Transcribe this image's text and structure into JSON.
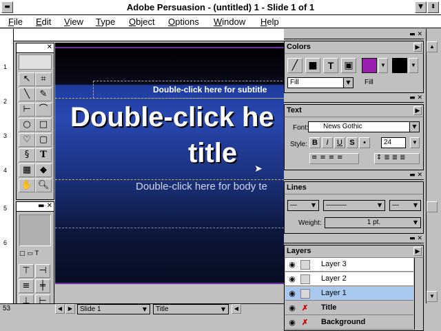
{
  "window": {
    "title": "Adobe Persuasion - (untitled) 1 - Slide 1 of 1"
  },
  "menu": [
    "File",
    "Edit",
    "View",
    "Type",
    "Object",
    "Options",
    "Window",
    "Help"
  ],
  "slide": {
    "subtitle_placeholder": "Double-click  here for subtitle",
    "title_line1": "Double-click he",
    "title_line2": "title",
    "body_placeholder": "Double-click here for body te"
  },
  "ruler": {
    "left_numbers": [
      "1",
      "2",
      "3",
      "4",
      "5",
      "6"
    ]
  },
  "colors_panel": {
    "title": "Colors",
    "fill_select": "Fill",
    "fill_label": "Fill",
    "swatch_color": "#9b1fae"
  },
  "text_panel": {
    "title": "Text",
    "font_label": "Font:",
    "font_value": "News Gothic",
    "style_label": "Style:",
    "size_value": "24",
    "style_buttons": [
      "B",
      "I",
      "U",
      "S",
      "•"
    ]
  },
  "lines_panel": {
    "title": "Lines",
    "weight_label": "Weight:",
    "weight_value": "1 pt."
  },
  "layers_panel": {
    "title": "Layers",
    "layers": [
      {
        "name": "Layer 3",
        "selected": false,
        "bold": false
      },
      {
        "name": "Layer 2",
        "selected": false,
        "bold": false
      },
      {
        "name": "Layer 1",
        "selected": true,
        "bold": false
      },
      {
        "name": "Title",
        "selected": false,
        "bold": true
      },
      {
        "name": "Background",
        "selected": false,
        "bold": true
      }
    ]
  },
  "status": {
    "zoom": "53",
    "slide_select": "Slide 1",
    "layer_select": "Title"
  },
  "icons": [
    "pointer-icon",
    "crop-icon",
    "line-icon",
    "pen-icon",
    "hline-icon",
    "arc-icon",
    "ellipse-icon",
    "rect-icon",
    "freeform-icon",
    "roundrect-icon",
    "clip-icon",
    "text-icon",
    "chart-icon",
    "eraser-icon",
    "hand-icon",
    "zoom-icon"
  ]
}
